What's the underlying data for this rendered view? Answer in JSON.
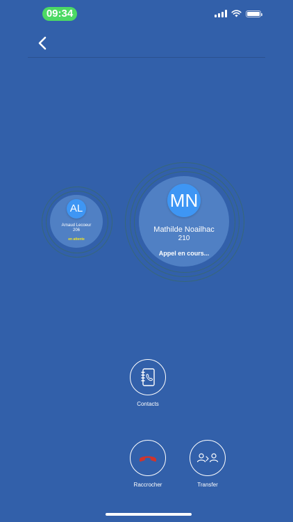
{
  "status_bar": {
    "time": "09:34"
  },
  "nav": {
    "back_icon": "chevron-left-icon"
  },
  "calls": [
    {
      "initials": "AL",
      "name": "Arnaud Lecoeur",
      "number": "206",
      "status": "en attente",
      "status_color": "#F5E623"
    },
    {
      "initials": "MN",
      "name": "Mathilde Noailhac",
      "number": "210",
      "status": "Appel en cours...",
      "status_color": "#FFFFFF"
    }
  ],
  "actions": {
    "contacts": {
      "label": "Contacts",
      "icon": "address-book-icon"
    },
    "hangup": {
      "label": "Raccrocher",
      "icon": "hang-up-icon",
      "color": "#D0342C"
    },
    "transfer": {
      "label": "Transfer",
      "icon": "transfer-icon"
    }
  },
  "colors": {
    "background": "#3260AA",
    "avatar": "#3E96F4",
    "bubble": "#5080C4",
    "time_pill": "#4CD964"
  }
}
